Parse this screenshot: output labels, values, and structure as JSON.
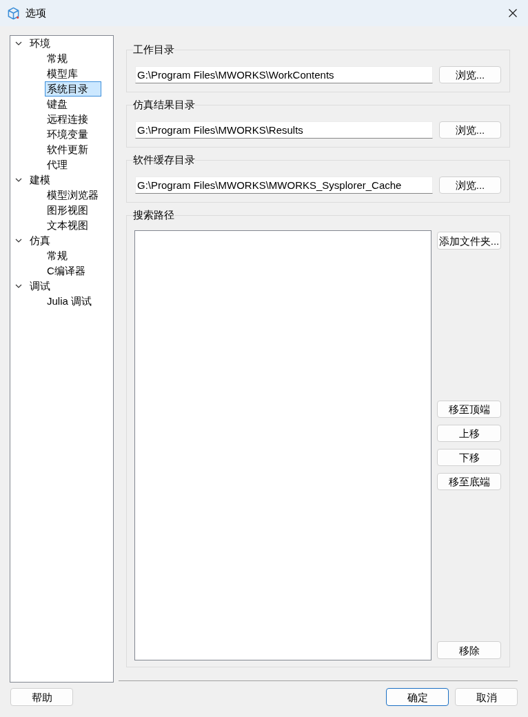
{
  "window": {
    "title": "选项"
  },
  "tree": [
    {
      "label": "环境",
      "expanded": true,
      "selected": false,
      "children": [
        {
          "label": "常规",
          "selected": false
        },
        {
          "label": "模型库",
          "selected": false
        },
        {
          "label": "系统目录",
          "selected": true
        },
        {
          "label": "键盘",
          "selected": false
        },
        {
          "label": "远程连接",
          "selected": false
        },
        {
          "label": "环境变量",
          "selected": false
        },
        {
          "label": "软件更新",
          "selected": false
        },
        {
          "label": "代理",
          "selected": false
        }
      ]
    },
    {
      "label": "建模",
      "expanded": true,
      "selected": false,
      "children": [
        {
          "label": "模型浏览器",
          "selected": false
        },
        {
          "label": "图形视图",
          "selected": false
        },
        {
          "label": "文本视图",
          "selected": false
        }
      ]
    },
    {
      "label": "仿真",
      "expanded": true,
      "selected": false,
      "children": [
        {
          "label": "常规",
          "selected": false
        },
        {
          "label": "C编译器",
          "selected": false
        }
      ]
    },
    {
      "label": "调试",
      "expanded": true,
      "selected": false,
      "children": [
        {
          "label": "Julia 调试",
          "selected": false
        }
      ]
    }
  ],
  "directory_groups": [
    {
      "title": "工作目录",
      "value": "G:\\Program Files\\MWORKS\\WorkContents",
      "button": "浏览..."
    },
    {
      "title": "仿真结果目录",
      "value": "G:\\Program Files\\MWORKS\\Results",
      "button": "浏览..."
    },
    {
      "title": "软件缓存目录",
      "value": "G:\\Program Files\\MWORKS\\MWORKS_Sysplorer_Cache",
      "button": "浏览..."
    }
  ],
  "search_path": {
    "title": "搜索路径",
    "add_button": "添加文件夹...",
    "move_buttons": [
      "移至顶端",
      "上移",
      "下移",
      "移至底端"
    ],
    "remove_button": "移除"
  },
  "footer": {
    "help_button": "帮助",
    "buttons": [
      {
        "label": "确定",
        "default": true
      },
      {
        "label": "取消",
        "default": false
      }
    ]
  }
}
